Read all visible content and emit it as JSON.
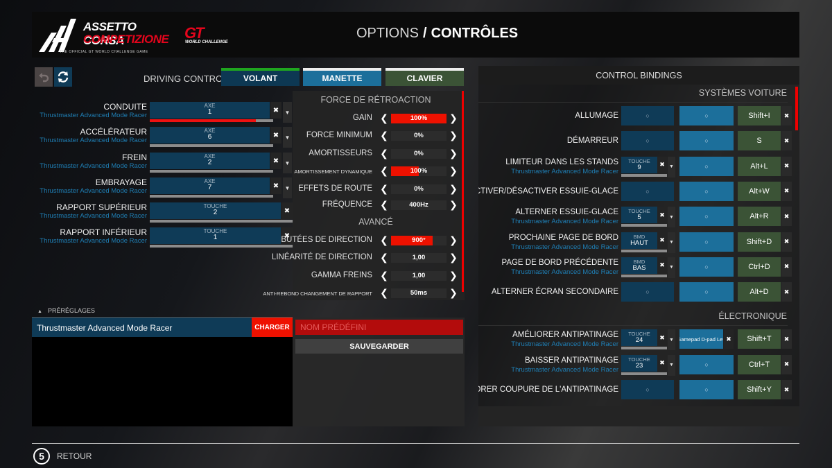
{
  "header": {
    "logo_acc": {
      "line1": "ASSETTO CORSA",
      "line2": "COMPETIZIONE",
      "tagline": "THE OFFICIAL GT WORLD CHALLENGE GAME"
    },
    "logo_gt": {
      "mark": "GT",
      "sub": "WORLD CHALLENGE"
    },
    "breadcrumb": "OPTIONS",
    "separator": "/",
    "title": "CONTRÔLES"
  },
  "toolbar": {
    "undo_icon": "undo-icon",
    "reset_icon": "refresh-icon"
  },
  "driving_control": {
    "label": "DRIVING CONTROL",
    "tabs": [
      {
        "label": "VOLANT",
        "active": true,
        "accent": "#1fa61f"
      },
      {
        "label": "MANETTE",
        "active": false
      },
      {
        "label": "CLAVIER",
        "active": false
      }
    ]
  },
  "axes": [
    {
      "name": "CONDUITE",
      "device": "Thrustmaster Advanced Mode Racer",
      "type": "AXE",
      "value": "1",
      "fill": 0.86,
      "has_dropdown": true
    },
    {
      "name": "ACCÉLÉRATEUR",
      "device": "Thrustmaster Advanced Mode Racer",
      "type": "AXE",
      "value": "6",
      "fill": 0,
      "has_dropdown": true
    },
    {
      "name": "FREIN",
      "device": "Thrustmaster Advanced Mode Racer",
      "type": "AXE",
      "value": "2",
      "fill": 0,
      "has_dropdown": true
    },
    {
      "name": "EMBRAYAGE",
      "device": "Thrustmaster Advanced Mode Racer",
      "type": "AXE",
      "value": "7",
      "fill": 0,
      "has_dropdown": true
    },
    {
      "name": "RAPPORT SUPÉRIEUR",
      "device": "Thrustmaster Advanced Mode Racer",
      "type": "TOUCHE",
      "value": "2",
      "fill": 0,
      "has_dropdown": false
    },
    {
      "name": "RAPPORT INFÉRIEUR",
      "device": "Thrustmaster Advanced Mode Racer",
      "type": "TOUCHE",
      "value": "1",
      "fill": 0,
      "has_dropdown": false
    }
  ],
  "ffb": {
    "title": "FORCE DE RÉTROACTION",
    "settings": [
      {
        "label": "GAIN",
        "value": "100%",
        "fill": 1.0,
        "small": false
      },
      {
        "label": "FORCE MINIMUM",
        "value": "0%",
        "fill": 0,
        "small": false
      },
      {
        "label": "AMORTISSEURS",
        "value": "0%",
        "fill": 0,
        "small": false
      },
      {
        "label": "AMORTISSEMENT DYNAMIQUE",
        "value": "100%",
        "fill": 0.5,
        "small": true
      },
      {
        "label": "EFFETS DE ROUTE",
        "value": "0%",
        "fill": 0,
        "small": false
      },
      {
        "label": "FRÉQUENCE",
        "value": "400Hz",
        "fill": 0,
        "small": false
      }
    ],
    "advanced_title": "AVANCÉ",
    "advanced": [
      {
        "label": "BUTÉES DE DIRECTION",
        "value": "900°",
        "fill": 0.75,
        "small": false
      },
      {
        "label": "LINÉARITÉ DE DIRECTION",
        "value": "1,00",
        "fill": 0,
        "small": false
      },
      {
        "label": "GAMMA FREINS",
        "value": "1,00",
        "fill": 0,
        "small": false
      },
      {
        "label": "ANTI-REBOND CHANGEMENT DE RAPPORT",
        "value": "50ms",
        "fill": 0,
        "small": true
      }
    ]
  },
  "presets": {
    "header": "PRÉRÉGLAGES",
    "items": [
      "Thrustmaster Advanced Mode Racer"
    ],
    "load_label": "CHARGER",
    "name_placeholder": "NOM PRÉDÉFINI",
    "save_label": "SAUVEGARDER"
  },
  "bindings": {
    "title": "CONTROL BINDINGS",
    "empty_symbol": "○",
    "sections": [
      {
        "title": "SYSTÈMES VOITURE",
        "rows": [
          {
            "name": "ALLUMAGE",
            "device": "",
            "wheel": null,
            "gamepad": "",
            "keyboard": "Shift+I"
          },
          {
            "name": "DÉMARREUR",
            "device": "",
            "wheel": null,
            "gamepad": "",
            "keyboard": "S"
          },
          {
            "name": "LIMITEUR DANS LES STANDS",
            "device": "Thrustmaster Advanced Mode Racer",
            "wheel": {
              "type": "TOUCHE",
              "value": "9"
            },
            "gamepad": "",
            "keyboard": "Alt+L"
          },
          {
            "name": "ACTIVER/DÉSACTIVER ESSUIE-GLACE",
            "device": "",
            "wheel": null,
            "gamepad": "",
            "keyboard": "Alt+W"
          },
          {
            "name": "ALTERNER ESSUIE-GLACE",
            "device": "Thrustmaster Advanced Mode Racer",
            "wheel": {
              "type": "TOUCHE",
              "value": "5"
            },
            "gamepad": "",
            "keyboard": "Alt+R"
          },
          {
            "name": "PROCHAINE PAGE DE BORD",
            "device": "Thrustmaster Advanced Mode Racer",
            "wheel": {
              "type": "BMD",
              "value": "HAUT"
            },
            "gamepad": "",
            "keyboard": "Shift+D"
          },
          {
            "name": "PAGE DE BORD PRÉCÉDENTE",
            "device": "Thrustmaster Advanced Mode Racer",
            "wheel": {
              "type": "BMD",
              "value": "BAS"
            },
            "gamepad": "",
            "keyboard": "Ctrl+D"
          },
          {
            "name": "ALTERNER ÉCRAN SECONDAIRE",
            "device": "",
            "wheel": null,
            "gamepad": "",
            "keyboard": "Alt+D"
          }
        ]
      },
      {
        "title": "ÉLECTRONIQUE",
        "rows": [
          {
            "name": "AMÉLIORER ANTIPATINAGE",
            "device": "Thrustmaster Advanced Mode Racer",
            "wheel": {
              "type": "TOUCHE",
              "value": "24"
            },
            "gamepad": "Gamepad D-pad Left",
            "keyboard": "Shift+T"
          },
          {
            "name": "BAISSER ANTIPATINAGE",
            "device": "Thrustmaster Advanced Mode Racer",
            "wheel": {
              "type": "TOUCHE",
              "value": "23"
            },
            "gamepad": "",
            "keyboard": "Ctrl+T"
          },
          {
            "name": "AMÉLIORER COUPURE DE L'ANTIPATINAGE",
            "device": "",
            "wheel": null,
            "gamepad": "",
            "keyboard": "Shift+Y"
          }
        ]
      }
    ]
  },
  "footer": {
    "back_key": "5",
    "back_label": "RETOUR"
  },
  "colors": {
    "accent_red": "#e10000",
    "wheel_blue": "#0f3b57",
    "gamepad_blue": "#1c6f9b",
    "keyboard_green": "#3b5336",
    "device_text": "#1f7fb5"
  }
}
